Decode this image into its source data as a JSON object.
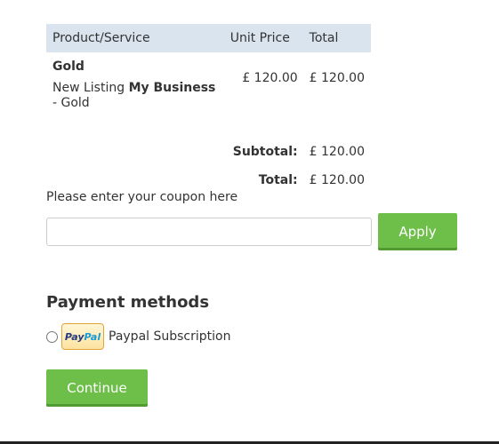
{
  "order": {
    "headers": {
      "product": "Product/Service",
      "unit_price": "Unit Price",
      "total": "Total"
    },
    "item": {
      "name": "Gold",
      "desc_prefix": "New Listing ",
      "desc_business": "My Business",
      "desc_suffix": " - Gold",
      "unit_price": "£ 120.00",
      "total": "£ 120.00"
    },
    "subtotal_label": "Subtotal:",
    "subtotal_value": "£ 120.00",
    "total_label": "Total:",
    "total_value": "£ 120.00"
  },
  "coupon": {
    "label": "Please enter your coupon here",
    "value": "",
    "placeholder": "",
    "apply_label": "Apply"
  },
  "payment": {
    "title": "Payment methods",
    "options": [
      {
        "label": "Paypal Subscription",
        "icon": "paypal-logo-icon",
        "selected": false,
        "logo_text_1": "Pay",
        "logo_text_2": "Pal"
      }
    ]
  },
  "continue_label": "Continue",
  "colors": {
    "header_bg": "#d9e4ee",
    "button_green": "#6dbf4a",
    "paypal_dark": "#253b80",
    "paypal_light": "#179bd7"
  }
}
